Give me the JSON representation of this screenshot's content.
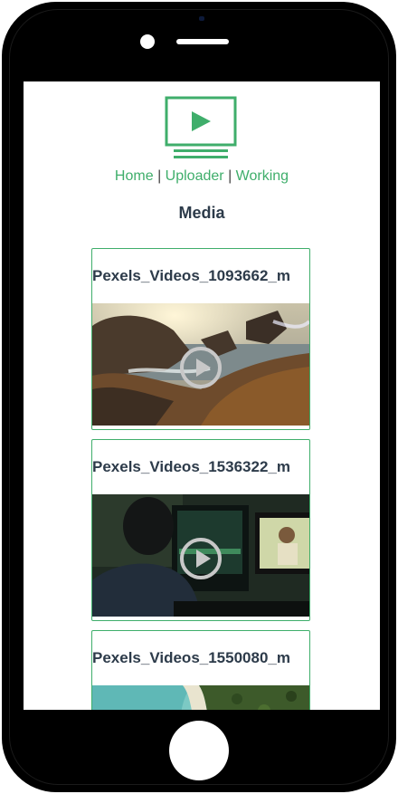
{
  "nav": {
    "home": "Home",
    "uploader": "Uploader",
    "working": "Working",
    "separator": "|"
  },
  "page": {
    "title": "Media"
  },
  "videos": [
    {
      "title": "Pexels_Videos_1093662_m"
    },
    {
      "title": "Pexels_Videos_1536322_m"
    },
    {
      "title": "Pexels_Videos_1550080_m"
    }
  ],
  "colors": {
    "accent": "#3fae6b",
    "heading": "#2d3b4a"
  },
  "icons": [
    "tv-play-logo-icon",
    "play-icon"
  ]
}
